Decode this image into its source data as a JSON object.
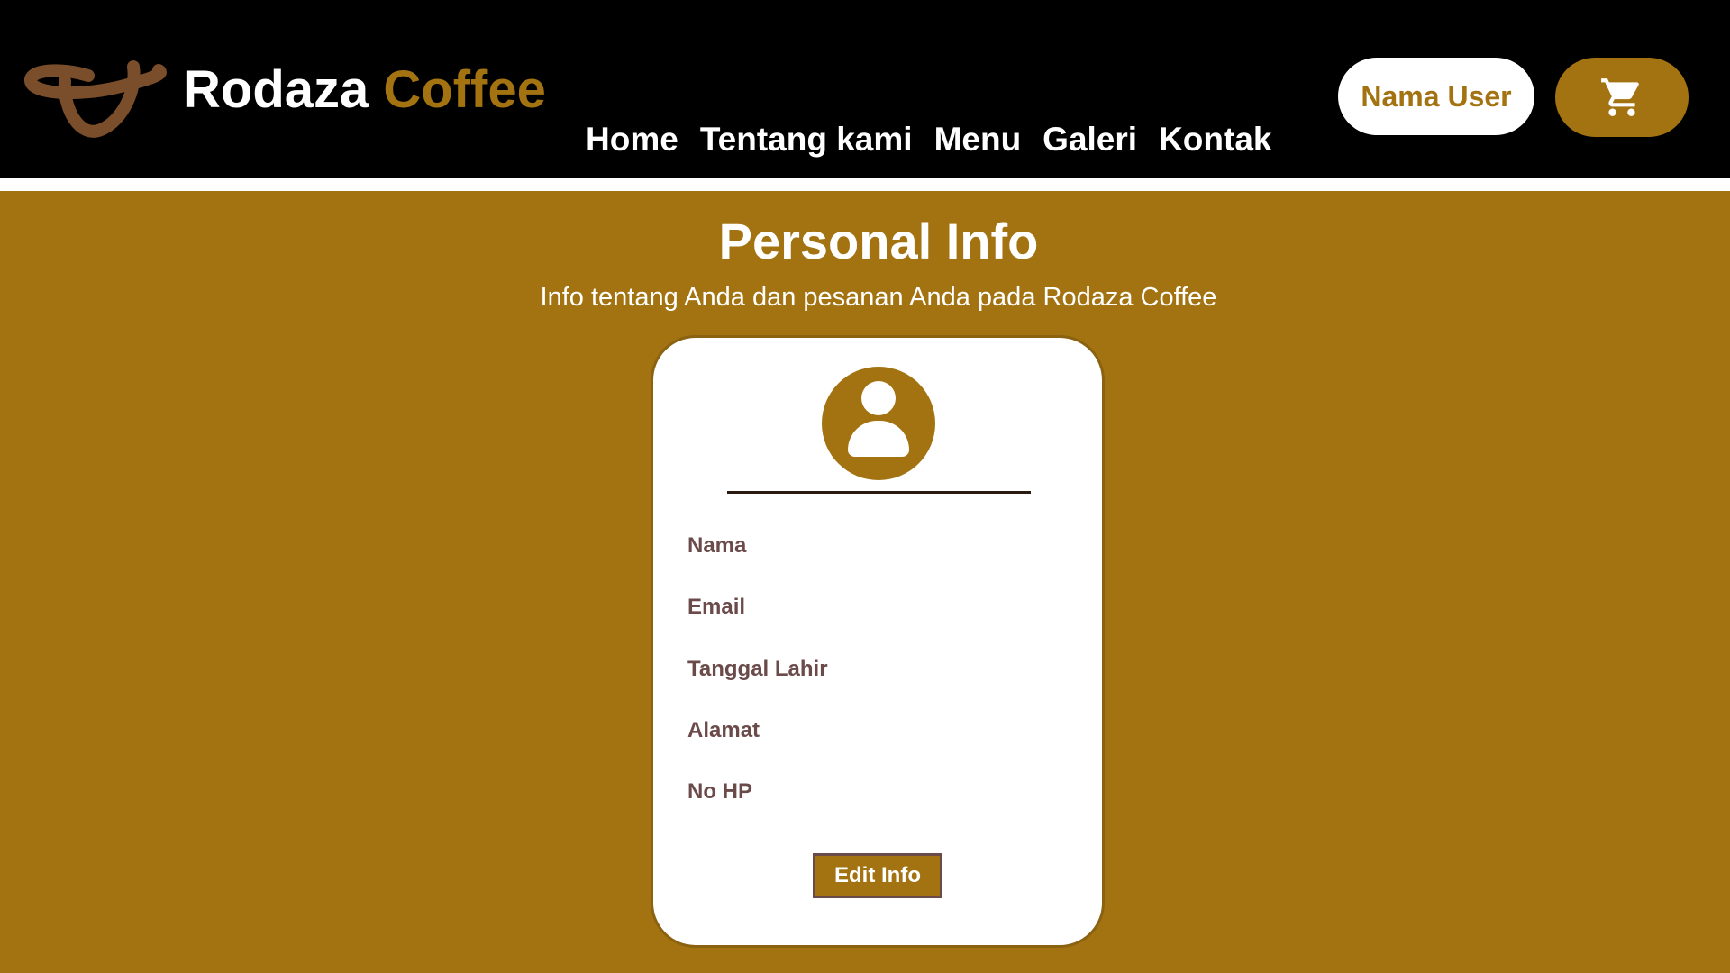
{
  "header": {
    "brand_first": "Rodaza",
    "brand_second": "Coffee",
    "logo_icon": "coffee-swirl-logo",
    "nav": [
      {
        "label": "Home"
      },
      {
        "label": "Tentang kami"
      },
      {
        "label": "Menu"
      },
      {
        "label": "Galeri"
      },
      {
        "label": "Kontak"
      }
    ],
    "user_button": "Nama User",
    "cart_icon": "cart-icon"
  },
  "main": {
    "title": "Personal Info",
    "subtitle": "Info tentang Anda dan pesanan Anda pada Rodaza Coffee",
    "card": {
      "avatar_icon": "user-avatar-icon",
      "fields": [
        {
          "label": "Nama"
        },
        {
          "label": "Email"
        },
        {
          "label": "Tanggal Lahir"
        },
        {
          "label": "Alamat"
        },
        {
          "label": "No HP"
        }
      ],
      "edit_button": "Edit Info"
    }
  },
  "colors": {
    "brand_gold": "#a37311",
    "header_black": "#000000",
    "logo_brown": "#7a4e2a",
    "label_text": "#6b4a4a",
    "white": "#ffffff"
  }
}
